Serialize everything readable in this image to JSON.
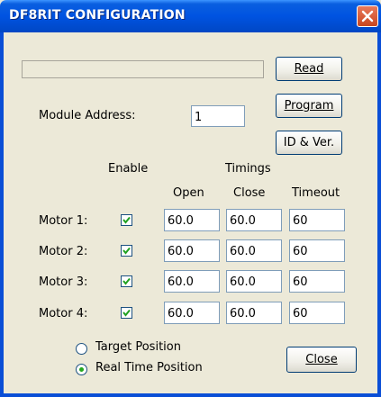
{
  "window": {
    "title": "DF8RIT CONFIGURATION"
  },
  "status_text": "",
  "buttons": {
    "read": "Read",
    "program": "Program",
    "id_ver": "ID & Ver.",
    "close": "Close"
  },
  "module_address": {
    "label": "Module Address:",
    "value": "1"
  },
  "headers": {
    "enable": "Enable",
    "timings": "Timings",
    "open": "Open",
    "close": "Close",
    "timeout": "Timeout"
  },
  "motors": [
    {
      "label": "Motor 1:",
      "enabled": true,
      "open": "60.0",
      "close": "60.0",
      "timeout": "60"
    },
    {
      "label": "Motor 2:",
      "enabled": true,
      "open": "60.0",
      "close": "60.0",
      "timeout": "60"
    },
    {
      "label": "Motor 3:",
      "enabled": true,
      "open": "60.0",
      "close": "60.0",
      "timeout": "60"
    },
    {
      "label": "Motor 4:",
      "enabled": true,
      "open": "60.0",
      "close": "60.0",
      "timeout": "60"
    }
  ],
  "position_mode": {
    "options": [
      "Target Position",
      "Real Time Position"
    ],
    "selected": "Real Time Position"
  }
}
